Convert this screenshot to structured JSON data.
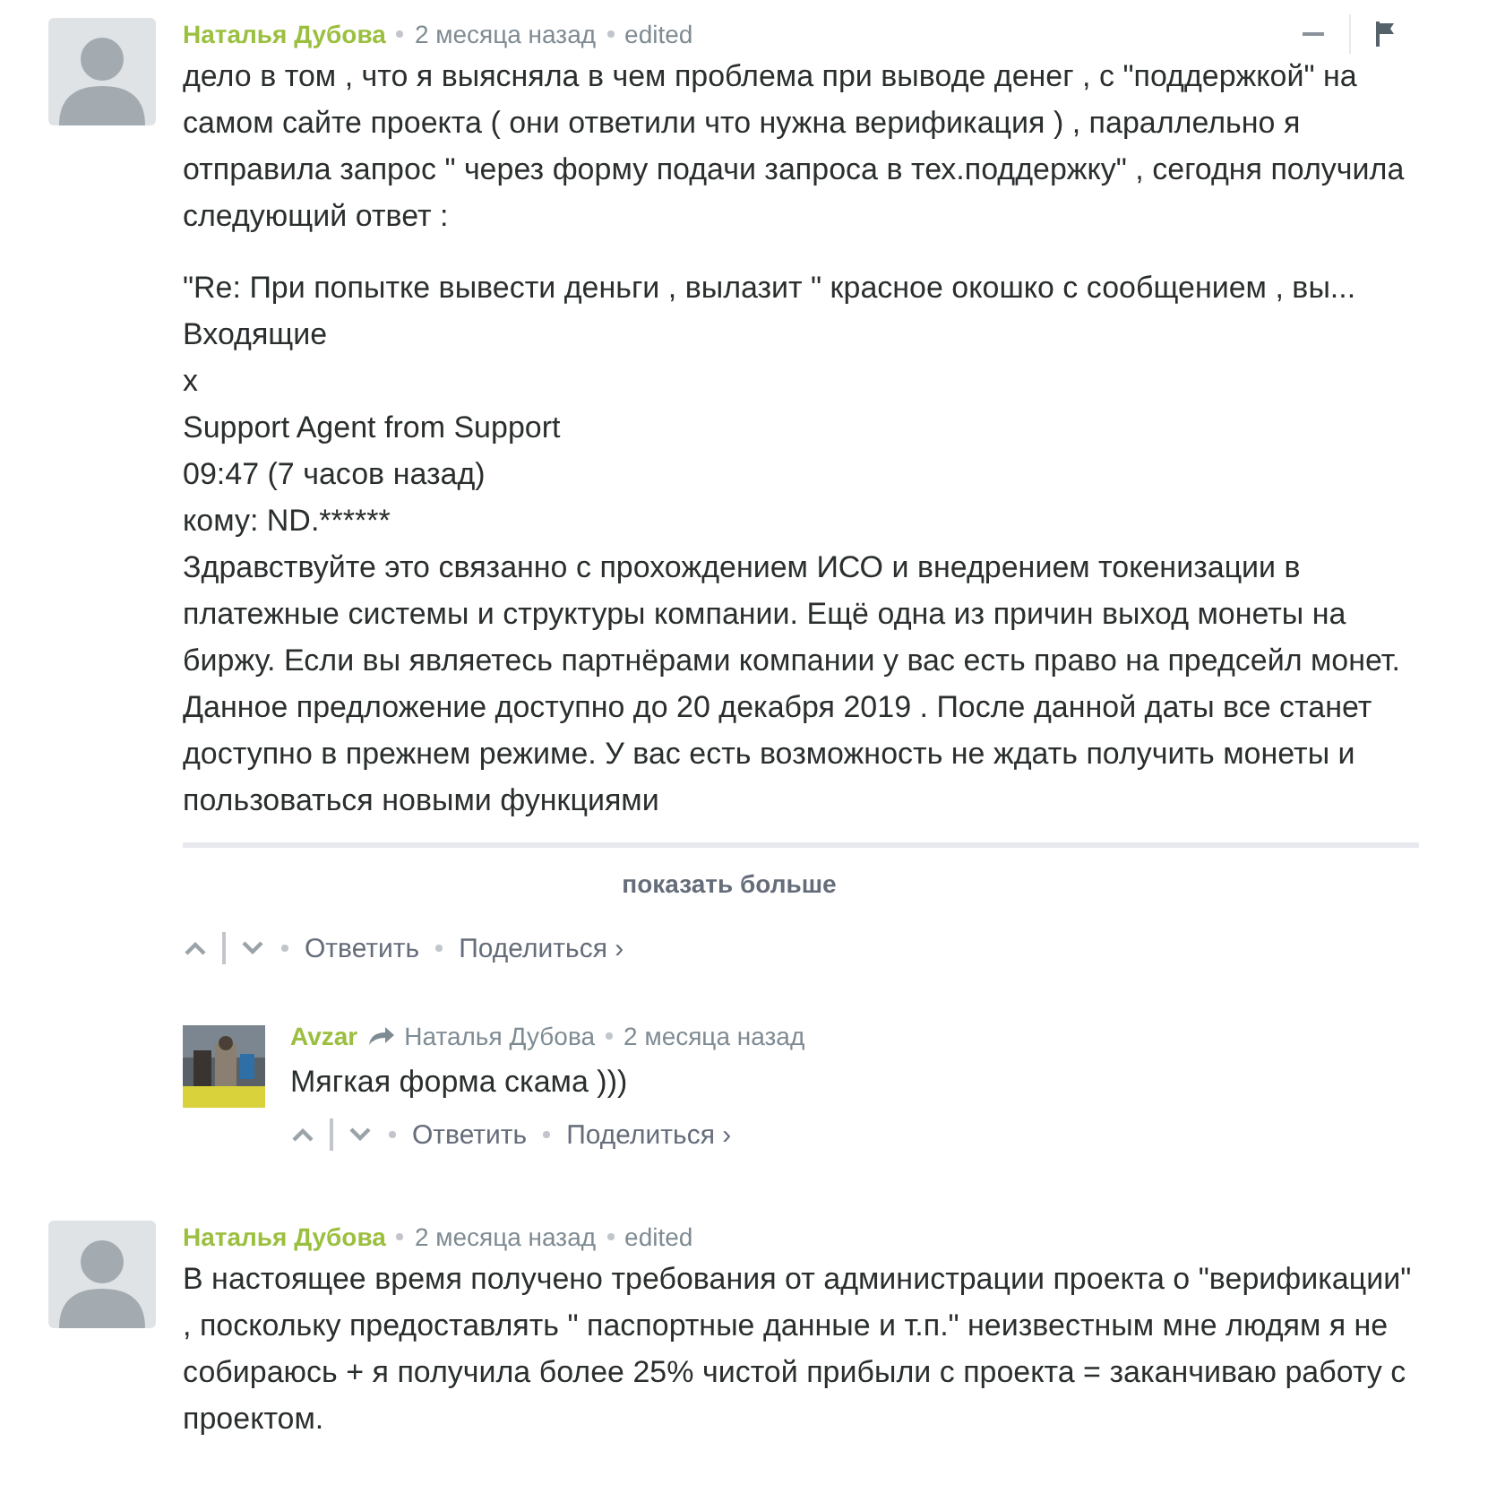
{
  "comments": [
    {
      "author": "Наталья Дубова",
      "time": "2 месяца назад",
      "edited": "edited",
      "header_controls": true,
      "blocks": [
        {
          "kind": "para",
          "text": "дело в том , что я выясняла в чем проблема при выводе денег , с \"поддержкой\" на самом сайте проекта ( они ответили что нужна верификация ) , параллельно я отправила запрос \" через форму подачи запроса в тех.поддержку\" , сегодня получила следующий ответ :"
        },
        {
          "kind": "lines",
          "lines": [
            "\"Re: При попытке вывести деньги , вылазит \" красное окошко с сообщением , вы...",
            "Входящие",
            "x",
            "Support Agent from Support",
            "09:47 (7 часов назад)",
            "кому: ND.******",
            "Здравствуйте это связанно с прохождением ИСО и внедрением токенизации в платежные системы и структуры компании. Ещё одна из причин выход монеты на биржу. Если вы являетесь партнёрами компании у вас есть право на предсейл монет. Данное предложение доступно до 20 декабря 2019 . После данной даты все станет доступно в прежнем режиме. У вас есть возможность не ждать получить монеты и пользоваться новыми функциями"
          ]
        }
      ],
      "show_more": "показать больше",
      "reply": "Ответить",
      "share": "Поделиться ›",
      "replies": [
        {
          "author": "Avzar",
          "reply_to": "Наталья Дубова",
          "time": "2 месяца назад",
          "text": "Мягкая форма скама )))",
          "reply": "Ответить",
          "share": "Поделиться ›"
        }
      ]
    },
    {
      "author": "Наталья Дубова",
      "time": "2 месяца назад",
      "edited": "edited",
      "header_controls": false,
      "blocks": [
        {
          "kind": "para",
          "text": "В настоящее время получено требования от администрации проекта о \"верификации\" , поскольку предоставлять \" паспортные данные и т.п.\" неизвестным мне людям я не собираюсь + я получила более 25% чистой прибыли с проекта = заканчиваю работу с проектом."
        }
      ]
    }
  ]
}
